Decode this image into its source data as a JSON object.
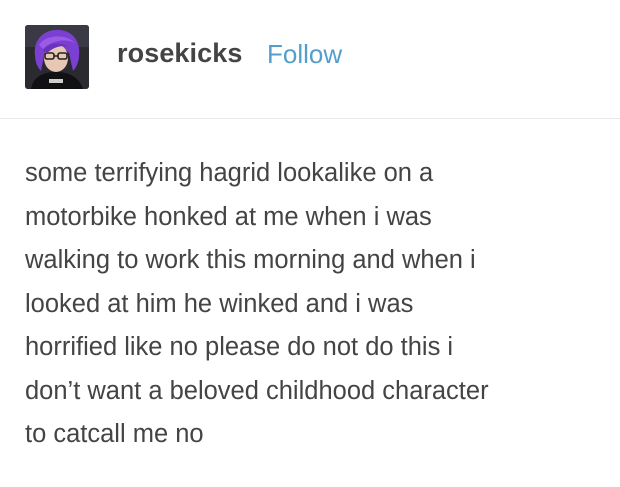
{
  "post": {
    "author": {
      "username": "rosekicks",
      "follow_label": "Follow",
      "avatar_icon": "user-avatar-photo"
    },
    "body": {
      "text": "some terrifying hagrid lookalike on a\nmotorbike honked at me when i was\nwalking to work this morning and when i\nlooked at him he winked and i was\nhorrified like no please do not do this i\ndon’t want a beloved childhood character\nto catcall me no"
    }
  },
  "colors": {
    "text": "#444444",
    "follow_link": "#529ecc",
    "divider": "#e8e8e8",
    "avatar_hair": "#7b3fd1"
  }
}
